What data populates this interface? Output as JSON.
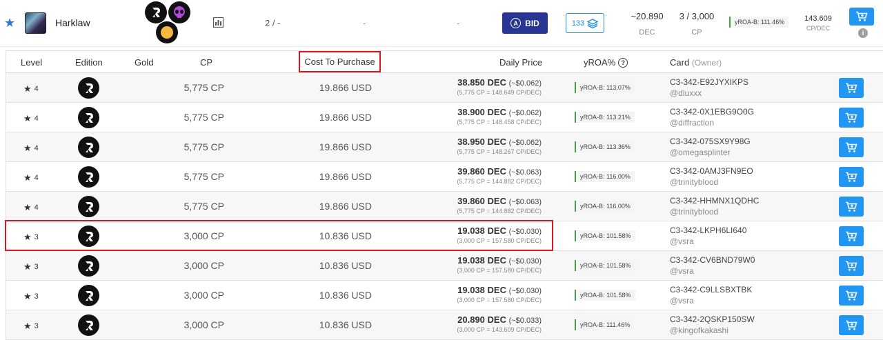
{
  "summary": {
    "card_name": "Harklaw",
    "fraction": "2 / -",
    "dash_a": "-",
    "dash_b": "-",
    "bid_label": "BID",
    "bid_icon_letter": "A",
    "stack_count": "133",
    "dec_value": "~20.890",
    "dec_unit": "DEC",
    "cp_value": "3 / 3,000",
    "cp_unit": "CP",
    "yroa": "yROA-B: 111.46%",
    "ratio_value": "143.609",
    "ratio_unit": "CP/DEC",
    "info_symbol": "i"
  },
  "table": {
    "headers": {
      "level": "Level",
      "edition": "Edition",
      "gold": "Gold",
      "cp": "CP",
      "cost": "Cost To Purchase",
      "daily_price": "Daily Price",
      "yroa": "yROA%",
      "yroa_help": "?",
      "card": "Card",
      "card_owner": "(Owner)"
    },
    "rows": [
      {
        "level": "4",
        "cp": "5,775 CP",
        "cost": "19.866 USD",
        "price_dec": "38.850 DEC",
        "price_usd": "(~$0.062)",
        "price_sub": "(5,775 CP = 148.649 CP/DEC)",
        "yroa": "yROA-B: 113.07%",
        "uid": "C3-342-E92JYXIKPS",
        "owner": "@dluxxx"
      },
      {
        "level": "4",
        "cp": "5,775 CP",
        "cost": "19.866 USD",
        "price_dec": "38.900 DEC",
        "price_usd": "(~$0.062)",
        "price_sub": "(5,775 CP = 148.458 CP/DEC)",
        "yroa": "yROA-B: 113.21%",
        "uid": "C3-342-0X1EBG9O0G",
        "owner": "@diffraction"
      },
      {
        "level": "4",
        "cp": "5,775 CP",
        "cost": "19.866 USD",
        "price_dec": "38.950 DEC",
        "price_usd": "(~$0.062)",
        "price_sub": "(5,775 CP = 148.267 CP/DEC)",
        "yroa": "yROA-B: 113.36%",
        "uid": "C3-342-075SX9Y98G",
        "owner": "@omegasplinter"
      },
      {
        "level": "4",
        "cp": "5,775 CP",
        "cost": "19.866 USD",
        "price_dec": "39.860 DEC",
        "price_usd": "(~$0.063)",
        "price_sub": "(5,775 CP = 144.882 CP/DEC)",
        "yroa": "yROA-B: 116.00%",
        "uid": "C3-342-0AMJ3FN9EO",
        "owner": "@trinityblood"
      },
      {
        "level": "4",
        "cp": "5,775 CP",
        "cost": "19.866 USD",
        "price_dec": "39.860 DEC",
        "price_usd": "(~$0.063)",
        "price_sub": "(5,775 CP = 144.882 CP/DEC)",
        "yroa": "yROA-B: 116.00%",
        "uid": "C3-342-HHMNX1QDHC",
        "owner": "@trinityblood"
      },
      {
        "level": "3",
        "cp": "3,000 CP",
        "cost": "10.836 USD",
        "price_dec": "19.038 DEC",
        "price_usd": "(~$0.030)",
        "price_sub": "(3,000 CP = 157.580 CP/DEC)",
        "yroa": "yROA-B: 101.58%",
        "uid": "C3-342-LKPH6LI640",
        "owner": "@vsra"
      },
      {
        "level": "3",
        "cp": "3,000 CP",
        "cost": "10.836 USD",
        "price_dec": "19.038 DEC",
        "price_usd": "(~$0.030)",
        "price_sub": "(3,000 CP = 157.580 CP/DEC)",
        "yroa": "yROA-B: 101.58%",
        "uid": "C3-342-CV6BND79W0",
        "owner": "@vsra"
      },
      {
        "level": "3",
        "cp": "3,000 CP",
        "cost": "10.836 USD",
        "price_dec": "19.038 DEC",
        "price_usd": "(~$0.030)",
        "price_sub": "(3,000 CP = 157.580 CP/DEC)",
        "yroa": "yROA-B: 101.58%",
        "uid": "C3-342-C9LLSBXTBK",
        "owner": "@vsra"
      },
      {
        "level": "3",
        "cp": "3,000 CP",
        "cost": "10.836 USD",
        "price_dec": "20.890 DEC",
        "price_usd": "(~$0.033)",
        "price_sub": "(3,000 CP = 143.609 CP/DEC)",
        "yroa": "yROA-B: 111.46%",
        "uid": "C3-342-2QSKP150SW",
        "owner": "@kingofkakashi"
      }
    ]
  },
  "icons": {
    "favorite": "star-icon",
    "level": "star-icon",
    "edition": "edition-logo-icon",
    "cart": "cart-icon",
    "chart": "chart-icon",
    "stack": "stack-icon"
  },
  "colors": {
    "accent_blue": "#2196f3",
    "bid_navy": "#283593",
    "highlight_red": "#e0141c",
    "yroa_green": "#43a047",
    "gold_coin": "#f3b941",
    "alien_purple": "#b04ad6"
  }
}
